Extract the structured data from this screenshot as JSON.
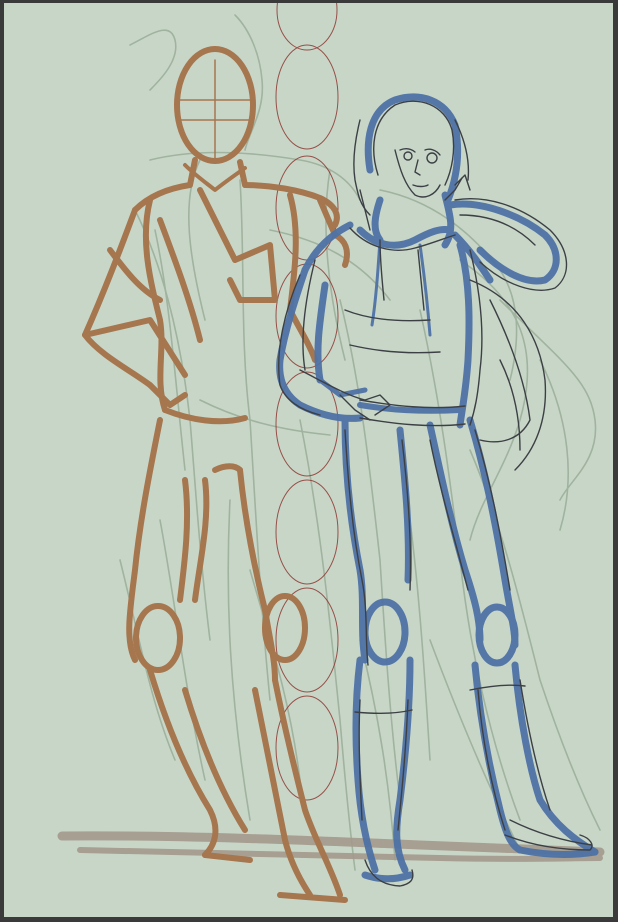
{
  "artwork": {
    "kind": "digital-sketch",
    "colors": {
      "paper": "#c8d6c8",
      "frame": "#3a3a3a",
      "mannequin": "#a6764e",
      "figure_blue": "#4e72a6",
      "lineart": "#3c4044",
      "construction_green": "#9aae98",
      "proportion_guides": "#8a2e28",
      "ground_shadow": "#a49a8c"
    },
    "layers": [
      {
        "name": "paper",
        "visible": true
      },
      {
        "name": "construction-gesture",
        "visible": true
      },
      {
        "name": "head-height-guides",
        "visible": true
      },
      {
        "name": "ground-shadow",
        "visible": true
      },
      {
        "name": "mannequin-figure",
        "visible": true
      },
      {
        "name": "blue-figure",
        "visible": true
      },
      {
        "name": "detail-lineart",
        "visible": true
      }
    ]
  }
}
